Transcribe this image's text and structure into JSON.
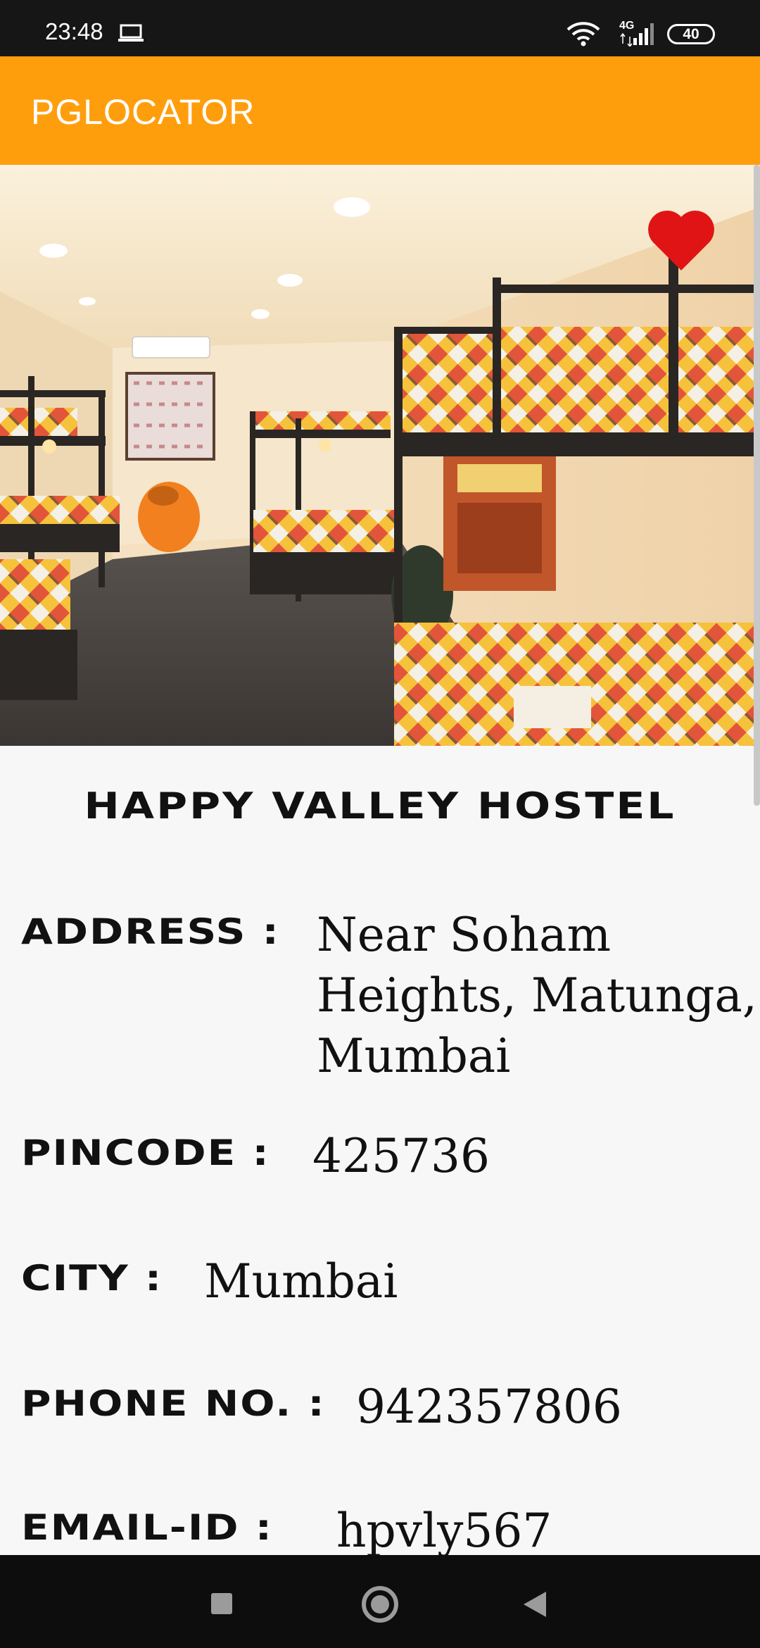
{
  "status_bar": {
    "time": "23:48",
    "network": "4G",
    "battery": "40",
    "icons": [
      "laptop-icon",
      "wifi-icon",
      "signal-icon",
      "battery-icon"
    ]
  },
  "app_bar": {
    "title": "PGLOCATOR"
  },
  "hostel": {
    "name": "HAPPY VALLEY HOSTEL",
    "favorite_icon": "heart-icon",
    "favorite_color": "#e01414"
  },
  "details": {
    "address_label": "ADDRESS :",
    "address_line1": "Near Soham",
    "address_line2": "Heights, Matunga,",
    "address_line3": "Mumbai",
    "pincode_label": "PINCODE :",
    "pincode": "425736",
    "city_label": "CITY :",
    "city": "Mumbai",
    "phone_label": "PHONE NO. :",
    "phone": "942357806",
    "email_label": "EMAIL-ID :",
    "email": "hpvly567"
  },
  "nav_bar": {
    "icons": [
      "recents-icon",
      "home-icon",
      "back-icon"
    ]
  },
  "colors": {
    "accent": "#ff9e0d",
    "background": "#f7f7f7",
    "status_bar": "#161616",
    "nav_bar": "#0d0d0d"
  }
}
